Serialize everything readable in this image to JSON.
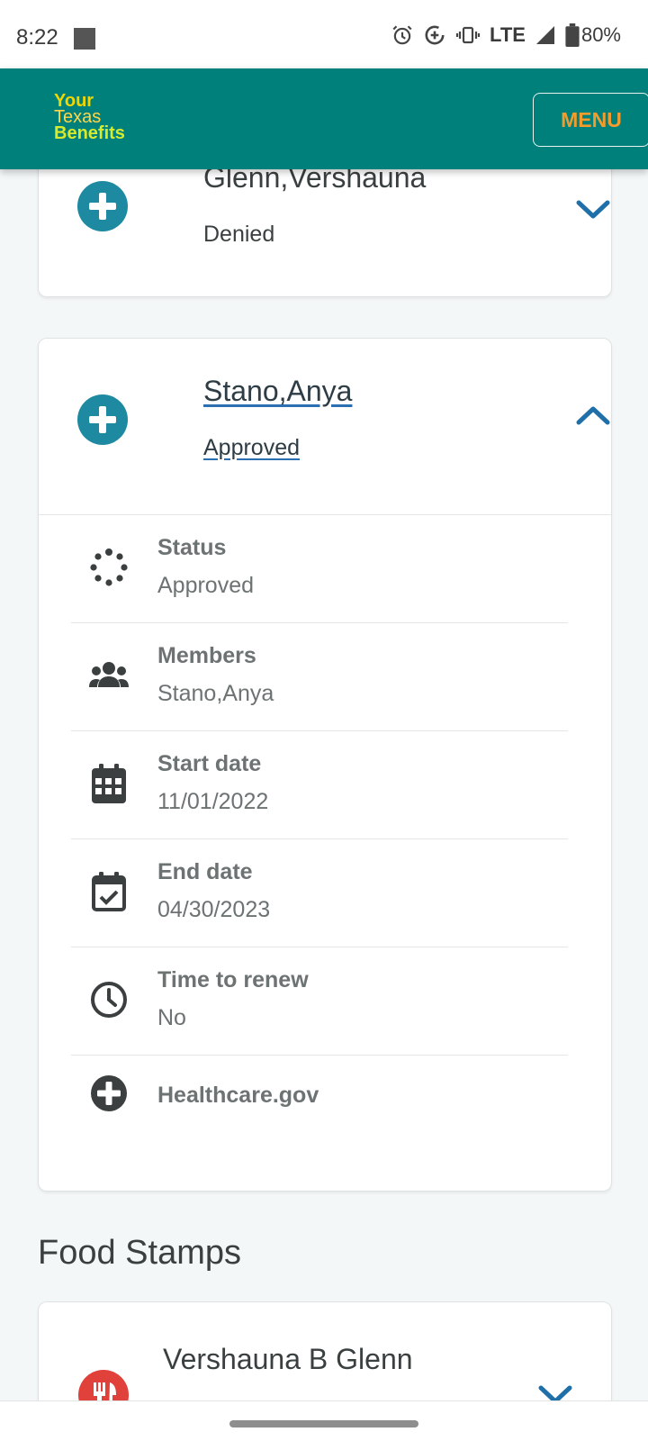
{
  "status_bar": {
    "time": "8:22",
    "network": "LTE",
    "battery": "80%",
    "icons": [
      "alarm-icon",
      "data-saver-icon",
      "vibrate-icon",
      "signal-icon",
      "battery-icon"
    ]
  },
  "header": {
    "logo_line1": "Your",
    "logo_line2": "Texas",
    "logo_line3": "Benefits",
    "menu_label": "MENU",
    "colors": {
      "bar": "#00807a",
      "menu_text": "#f39c2e"
    }
  },
  "cases": [
    {
      "name": "Glenn,Vershauna",
      "status": "Denied",
      "expanded": false
    },
    {
      "name": "Stano,Anya",
      "status": "Approved",
      "expanded": true,
      "details": [
        {
          "icon": "status-spinner-icon",
          "label": "Status",
          "value": "Approved"
        },
        {
          "icon": "members-icon",
          "label": "Members",
          "value": "Stano,Anya"
        },
        {
          "icon": "calendar-icon",
          "label": "Start date",
          "value": "11/01/2022"
        },
        {
          "icon": "calendar-check-icon",
          "label": "End date",
          "value": "04/30/2023"
        },
        {
          "icon": "clock-icon",
          "label": "Time to renew",
          "value": "No"
        }
      ],
      "link": {
        "icon": "plus-circle-icon",
        "label": "Healthcare.gov"
      }
    }
  ],
  "food_section": {
    "title": "Food Stamps",
    "cases": [
      {
        "name": "Vershauna B Glenn",
        "icon": "fork-knife-icon"
      }
    ]
  }
}
